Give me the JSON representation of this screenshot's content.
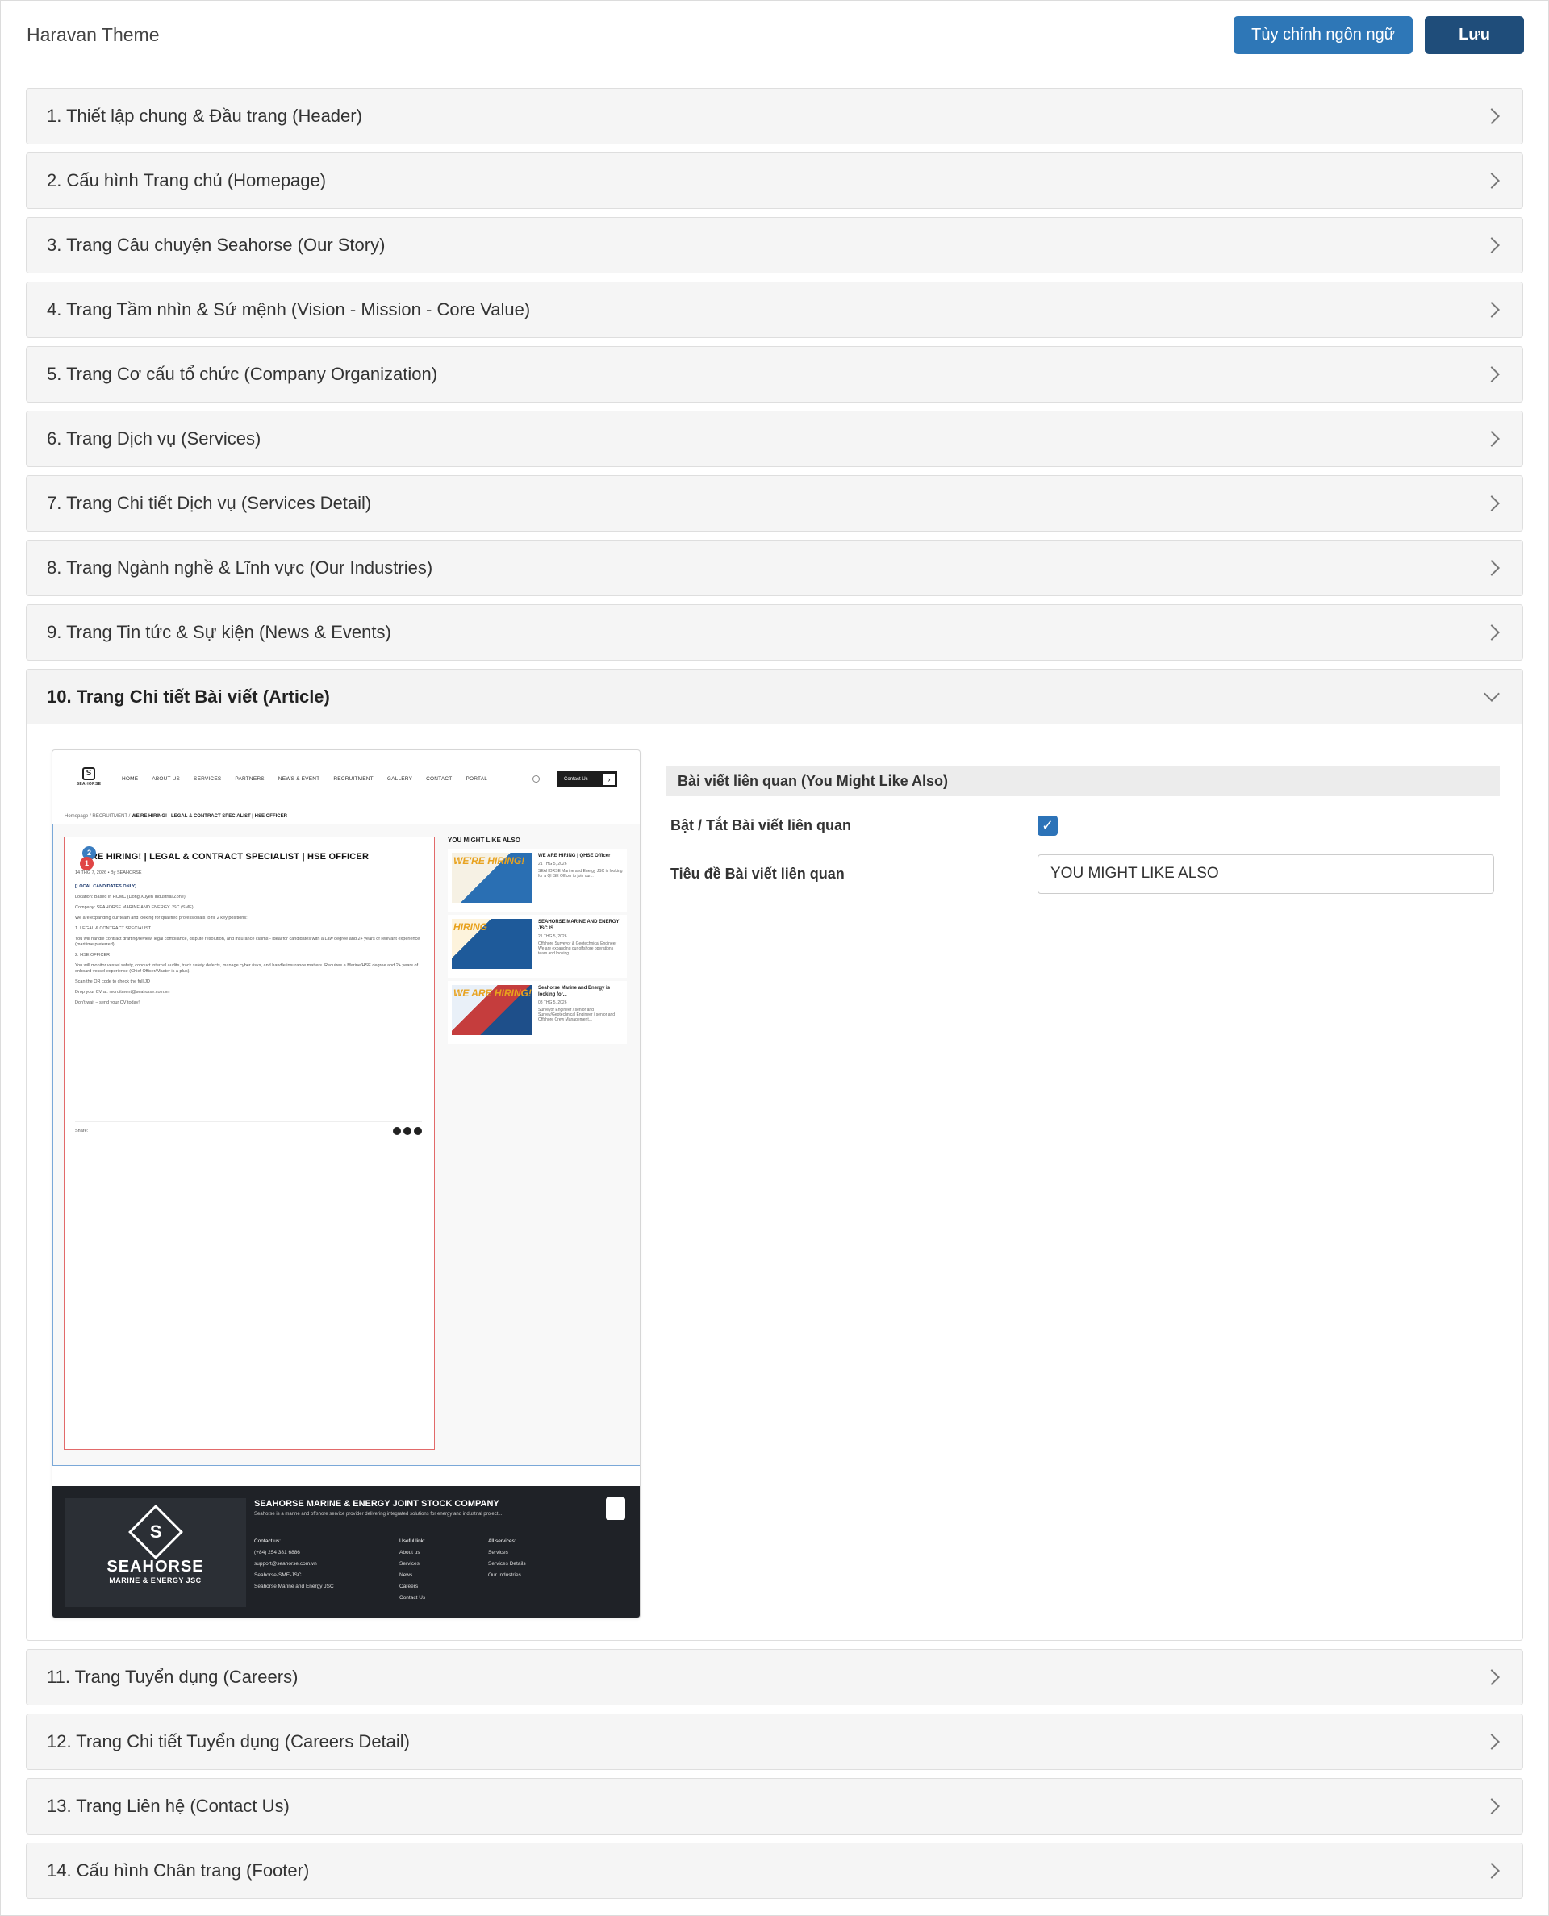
{
  "header": {
    "title": "Haravan Theme",
    "lang_button": "Tùy chỉnh ngôn ngữ",
    "save_button": "Lưu"
  },
  "sections": [
    "1. Thiết lập chung & Đầu trang (Header)",
    "2. Cấu hình Trang chủ (Homepage)",
    "3. Trang Câu chuyện Seahorse (Our Story)",
    "4. Trang Tầm nhìn & Sứ mệnh (Vision - Mission - Core Value)",
    "5. Trang Cơ cấu tổ chức (Company Organization)",
    "6. Trang Dịch vụ (Services)",
    "7. Trang Chi tiết Dịch vụ (Services Detail)",
    "8. Trang Ngành nghề & Lĩnh vực (Our Industries)",
    "9. Trang Tin tức & Sự kiện (News & Events)",
    "10. Trang Chi tiết Bài viết (Article)",
    "11. Trang Tuyển dụng (Careers)",
    "12. Trang Chi tiết Tuyển dụng (Careers Detail)",
    "13. Trang Liên hệ (Contact Us)",
    "14. Cấu hình Chân trang (Footer)"
  ],
  "open_section_index": 9,
  "settings": {
    "section_title": "Bài viết liên quan (You Might Like Also)",
    "toggle_label": "Bật / Tắt Bài viết liên quan",
    "toggle_checked": true,
    "title_label": "Tiêu đề Bài viết liên quan",
    "title_value": "YOU MIGHT LIKE ALSO"
  },
  "preview": {
    "logo_text": "SEAHORSE",
    "menu": [
      "HOME",
      "ABOUT US",
      "SERVICES",
      "PARTNERS",
      "NEWS & EVENT",
      "RECRUITMENT",
      "GALLERY",
      "CONTACT",
      "PORTAL"
    ],
    "contact_btn": "Contact Us",
    "crumb_home": "Homepage",
    "crumb_mid": "RECRUITMENT",
    "crumb_current": "WE'RE HIRING! | LEGAL & CONTRACT SPECIALIST | HSE OFFICER",
    "badge1": "1",
    "badge2": "2",
    "article_title": "'RE HIRING! | LEGAL & CONTRACT SPECIALIST | HSE OFFICER",
    "article_meta": "14 THG 7, 2026  •  By SEAHORSE",
    "article_lines": [
      "[LOCAL CANDIDATES ONLY]",
      "Location: Based in HCMC (Dong Xuyen Industrial Zone)",
      "Company: SEAHORSE MARINE AND ENERGY JSC (SME)",
      "We are expanding our team and looking for qualified professionals to fill 2 key positions:",
      "1. LEGAL & CONTRACT SPECIALIST",
      "You will handle contract drafting/review, legal compliance, dispute resolution, and insurance claims - ideal for candidates with a Law degree and 2+ years of relevant experience (maritime preferred).",
      "2. HSE OFFICER",
      "You will monitor vessel safety, conduct internal audits, track safety defects, manage cyber risks, and handle insurance matters. Requires a Marine/HSE degree and 2+ years of onboard vessel experience (Chief Officer/Master is a plus).",
      "Scan the QR code to check the full JD",
      "Drop your CV at: recruitment@seahorse.com.vn",
      "Don't wait – send your CV today!"
    ],
    "share_label": "Share:",
    "side_title": "YOU MIGHT LIKE ALSO",
    "side_cards": [
      {
        "thumb": "WE'RE HIRING!",
        "title": "WE ARE HIRING | QHSE Officer",
        "date": "21 THG 5, 2026",
        "desc": "SEAHORSE Marine and Energy JSC is looking for a QHSE Officer to join our..."
      },
      {
        "thumb": "HIRING",
        "title": "SEAHORSE MARINE AND ENERGY JSC IS...",
        "date": "21 THG 5, 2026",
        "desc": "Offshore Surveyor & Geotechnical Engineer We are expanding our offshore operations team and looking..."
      },
      {
        "thumb": "WE ARE HIRING!",
        "title": "Seahorse Marine and Energy is looking for...",
        "date": "08 THG 5, 2026",
        "desc": "Surveyor Engineer / senior and Survey/Geotechnical Engineer / senior and Offshore Crew Management..."
      }
    ],
    "footer": {
      "brand": "SEAHORSE",
      "brand_sub": "MARINE & ENERGY JSC",
      "company": "SEAHORSE MARINE & ENERGY JOINT STOCK COMPANY",
      "tagline": "Seahorse is a marine and offshore service provider delivering integrated solutions for energy and industrial project...",
      "contact_title": "Contact us:",
      "contact": [
        "(+84) 254 381 6886",
        "support@seahorse.com.vn",
        "Seahorse-SME-JSC",
        "Seahorse Marine and Energy JSC"
      ],
      "useful_title": "Useful link:",
      "useful": [
        "About us",
        "Services",
        "News",
        "Careers",
        "Contact Us"
      ],
      "services_title": "All services:",
      "services": [
        "Services",
        "Services Details",
        "Our Industries"
      ]
    }
  }
}
